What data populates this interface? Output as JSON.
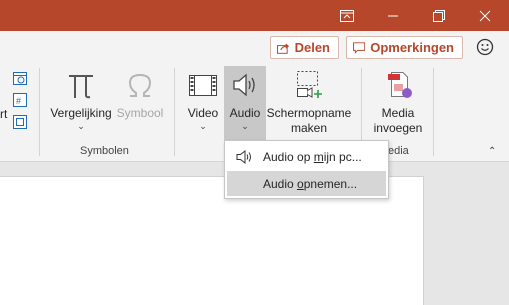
{
  "colors": {
    "accent": "#b7472a",
    "ribbon": "#f3f3f3",
    "hover": "#d6d6d6"
  },
  "titlebar": {
    "buttons": [
      "ribbon-display-icon",
      "minimize-icon",
      "restore-icon",
      "close-icon"
    ]
  },
  "sharebar": {
    "share_label": "Delen",
    "comments_label": "Opmerkingen"
  },
  "ribbon": {
    "left_partial_label": "rt",
    "symbols": {
      "equation_label": "Vergelijking",
      "symbol_label": "Symbool",
      "group_label": "Symbolen"
    },
    "media": {
      "video_label": "Video",
      "audio_label": "Audio",
      "screen_recording_line1": "Schermopname",
      "screen_recording_line2": "maken",
      "insert_media_line1": "Media",
      "insert_media_line2": "invoegen",
      "group_label_partial": "edia"
    }
  },
  "dropdown": {
    "items": [
      {
        "pre": "Audio op ",
        "ul": "m",
        "post": "ijn pc..."
      },
      {
        "pre": "Audio ",
        "ul": "o",
        "post": "pnemen..."
      }
    ]
  }
}
